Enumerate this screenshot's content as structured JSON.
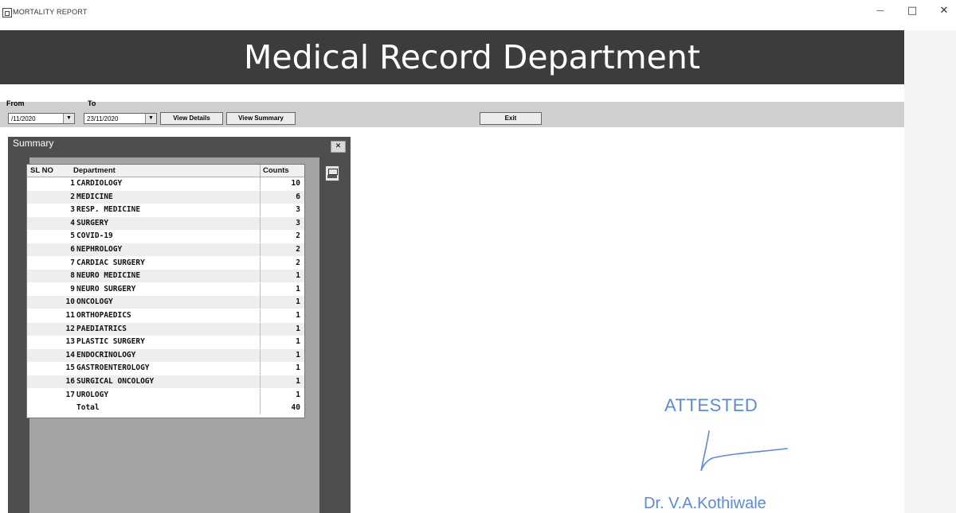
{
  "window": {
    "title": "MORTALITY REPORT",
    "minimize_glyph": "—",
    "maximize_glyph": "□",
    "close_glyph": "✕"
  },
  "banner": {
    "title": "Medical Record Department"
  },
  "toolbar": {
    "from_label": "From",
    "to_label": "To",
    "from_date": "/11/2020",
    "to_date": "23/11/2020",
    "view_details_label": "View Details",
    "view_summary_label": "View Summary",
    "exit_label": "Exit"
  },
  "summary": {
    "title": "Summary",
    "close_glyph": "✕",
    "columns": {
      "sl_no": "SL NO",
      "department": "Department",
      "counts": "Counts"
    },
    "rows": [
      {
        "sl": "1",
        "dept": "CARDIOLOGY",
        "count": "10"
      },
      {
        "sl": "2",
        "dept": "MEDICINE",
        "count": "6"
      },
      {
        "sl": "3",
        "dept": "RESP. MEDICINE",
        "count": "3"
      },
      {
        "sl": "4",
        "dept": "SURGERY",
        "count": "3"
      },
      {
        "sl": "5",
        "dept": "COVID-19",
        "count": "2"
      },
      {
        "sl": "6",
        "dept": "NEPHROLOGY",
        "count": "2"
      },
      {
        "sl": "7",
        "dept": "CARDIAC SURGERY",
        "count": "2"
      },
      {
        "sl": "8",
        "dept": "NEURO MEDICINE",
        "count": "1"
      },
      {
        "sl": "9",
        "dept": "NEURO SURGERY",
        "count": "1"
      },
      {
        "sl": "10",
        "dept": "ONCOLOGY",
        "count": "1"
      },
      {
        "sl": "11",
        "dept": "ORTHOPAEDICS",
        "count": "1"
      },
      {
        "sl": "12",
        "dept": "PAEDIATRICS",
        "count": "1"
      },
      {
        "sl": "13",
        "dept": "PLASTIC SURGERY",
        "count": "1"
      },
      {
        "sl": "14",
        "dept": "ENDOCRINOLOGY",
        "count": "1"
      },
      {
        "sl": "15",
        "dept": "GASTROENTEROLOGY",
        "count": "1"
      },
      {
        "sl": "16",
        "dept": "SURGICAL ONCOLOGY",
        "count": "1"
      },
      {
        "sl": "17",
        "dept": "UROLOGY",
        "count": "1"
      }
    ],
    "total_label": "Total",
    "total_count": "40"
  },
  "attestation": {
    "stamp": "ATTESTED",
    "name": "Dr. V.A.Kothiwale",
    "color": "#5a8ae0"
  }
}
